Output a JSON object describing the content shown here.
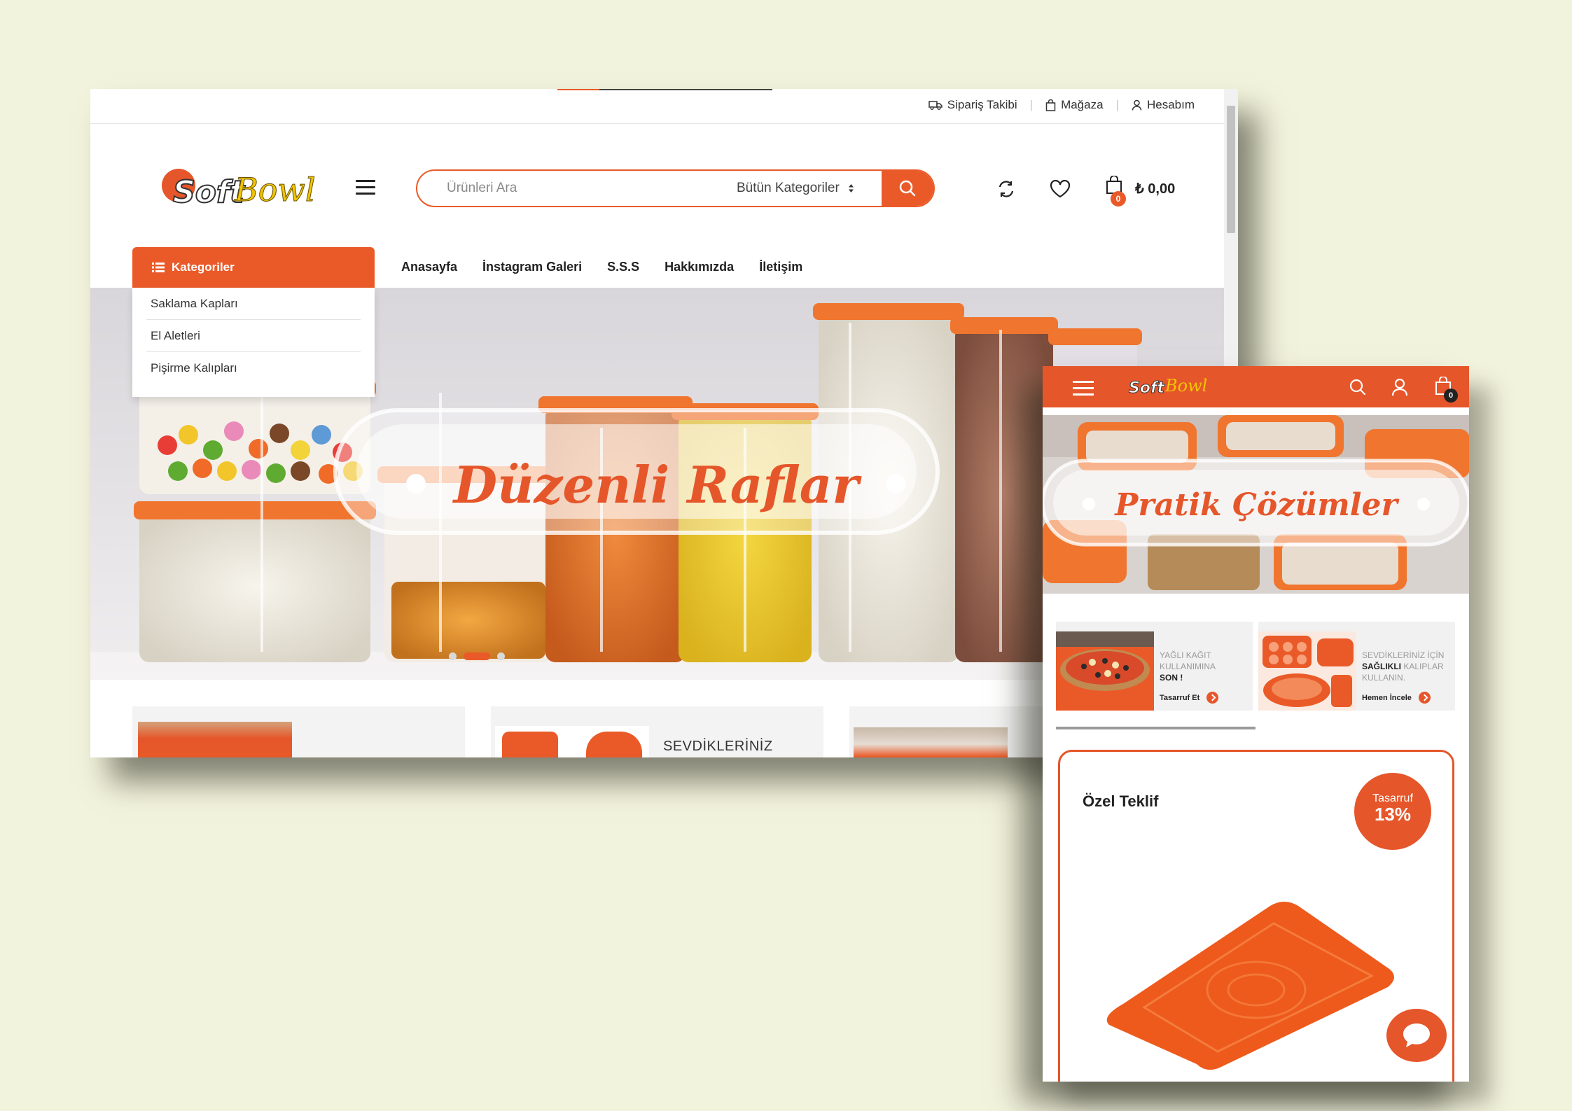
{
  "colors": {
    "background": "#f2f3dc",
    "accent": "#ea5a28",
    "accent_mobile": "#e5562a"
  },
  "brand": {
    "part1": "Soft",
    "part2": "Bowl"
  },
  "topbar": {
    "order_tracking": "Sipariş Takibi",
    "store": "Mağaza",
    "account": "Hesabım",
    "icons": [
      "truck-icon",
      "shopping-bag-icon",
      "user-icon"
    ]
  },
  "search": {
    "placeholder": "Ürünleri Ara",
    "category_select": "Bütün Kategoriler"
  },
  "cart": {
    "count": "0",
    "total": "₺ 0,00"
  },
  "categories": {
    "button_label": "Kategoriler",
    "items": [
      "Saklama Kapları",
      "El Aletleri",
      "Pişirme Kalıpları"
    ]
  },
  "nav": [
    "Anasayfa",
    "İnstagram Galeri",
    "S.S.S",
    "Hakkımızda",
    "İletişim"
  ],
  "hero": {
    "title": "Düzenli Raflar"
  },
  "cards": {
    "second_title": "SEVDİKLERİNİZ"
  },
  "mobile": {
    "cart_count": "0",
    "hero_title": "Pratik Çözümler",
    "promo1": {
      "line1": "YAĞLI KAĞIT",
      "line2": "KULLANIMINA",
      "line3": "SON !",
      "link": "Tasarruf Et"
    },
    "promo2": {
      "line1": "SEVDİKLERİNİZ İÇİN",
      "line2_bold": "SAĞLIKLI",
      "line2_rest": " KALIPLAR",
      "line3": "KULLANIN.",
      "link": "Hemen İncele"
    },
    "offer": {
      "title": "Özel Teklif",
      "save_label": "Tasarruf",
      "save_value": "13%"
    }
  }
}
